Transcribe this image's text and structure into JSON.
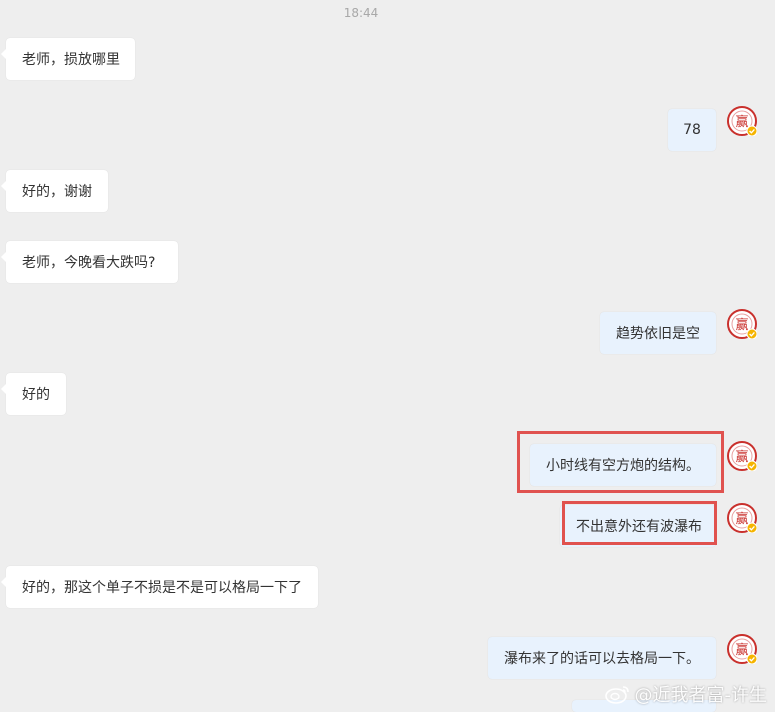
{
  "chat": {
    "timestamp": "18:44",
    "messages": [
      {
        "side": "left",
        "text": "老师，损放哪里"
      },
      {
        "side": "right",
        "text": "78"
      },
      {
        "side": "left",
        "text": "好的，谢谢"
      },
      {
        "side": "left",
        "text": "老师，今晚看大跌吗?"
      },
      {
        "side": "right",
        "text": "趋势依旧是空"
      },
      {
        "side": "left",
        "text": "好的"
      },
      {
        "side": "right",
        "text": "小时线有空方炮的结构。"
      },
      {
        "side": "right",
        "text": "不出意外还有波瀑布"
      },
      {
        "side": "left",
        "text": "好的，那这个单子不损是不是可以格局一下了"
      },
      {
        "side": "right",
        "text": "瀑布来了的话可以去格局一下。"
      }
    ]
  },
  "avatar": {
    "glyph": "赢",
    "color": "#c9302c",
    "badge_color": "#f5b400"
  },
  "highlight_color": "#e0524f",
  "watermark": {
    "text": "@近我者富-许生",
    "icon": "weibo-icon"
  }
}
